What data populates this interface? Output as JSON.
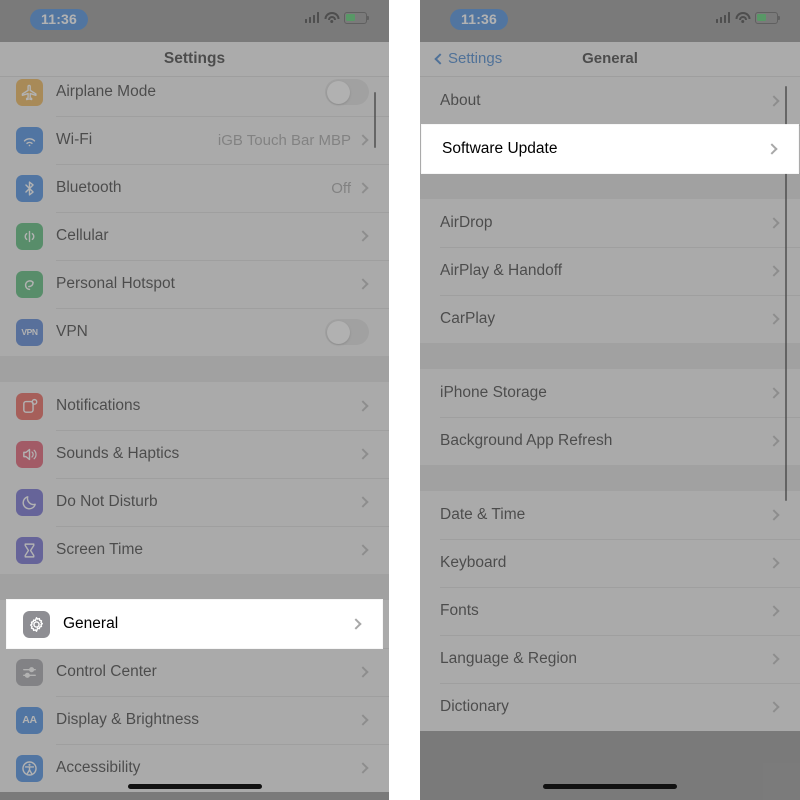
{
  "theme": {
    "accent": "#1a6fd4",
    "list_bg": "#ededed",
    "group_gap_bg": "#d7d7d7",
    "dim_overlay": "#7b7b7b",
    "highlight_bg": "#ffffff",
    "chevron": "#a8a8a8"
  },
  "left_phone": {
    "status_bar": {
      "time": "11:36",
      "cellular_icon": "cellular-signal-icon",
      "wifi_icon": "wifi-icon",
      "battery_icon": "battery-icon",
      "battery_level_percent": 46
    },
    "nav": {
      "title": "Settings"
    },
    "groups": [
      {
        "rows": [
          {
            "label": "Airplane Mode",
            "icon": "airplane-icon",
            "icon_class": "ic-airplane",
            "accessory": "toggle",
            "toggle_on": false,
            "clipped": true
          },
          {
            "label": "Wi-Fi",
            "icon": "wifi-icon",
            "icon_class": "ic-wifi",
            "accessory": "chevron",
            "value": "iGB Touch Bar MBP"
          },
          {
            "label": "Bluetooth",
            "icon": "bluetooth-icon",
            "icon_class": "ic-bluetooth",
            "accessory": "chevron",
            "value": "Off"
          },
          {
            "label": "Cellular",
            "icon": "cellular-icon",
            "icon_class": "ic-cellular",
            "accessory": "chevron",
            "value": ""
          },
          {
            "label": "Personal Hotspot",
            "icon": "hotspot-icon",
            "icon_class": "ic-hotspot",
            "accessory": "chevron",
            "value": ""
          },
          {
            "label": "VPN",
            "icon": "vpn-icon",
            "icon_class": "ic-vpn",
            "accessory": "toggle",
            "toggle_on": false
          }
        ]
      },
      {
        "rows": [
          {
            "label": "Notifications",
            "icon": "notifications-icon",
            "icon_class": "ic-notif",
            "accessory": "chevron",
            "value": ""
          },
          {
            "label": "Sounds & Haptics",
            "icon": "sounds-icon",
            "icon_class": "ic-sounds",
            "accessory": "chevron",
            "value": ""
          },
          {
            "label": "Do Not Disturb",
            "icon": "moon-icon",
            "icon_class": "ic-dnd",
            "accessory": "chevron",
            "value": ""
          },
          {
            "label": "Screen Time",
            "icon": "hourglass-icon",
            "icon_class": "ic-screentime",
            "accessory": "chevron",
            "value": ""
          }
        ]
      },
      {
        "rows": [
          {
            "label": "General",
            "icon": "gear-icon",
            "icon_class": "ic-general",
            "accessory": "chevron",
            "value": "",
            "highlighted": true
          },
          {
            "label": "Control Center",
            "icon": "control-center-icon",
            "icon_class": "ic-control",
            "accessory": "chevron",
            "value": ""
          },
          {
            "label": "Display & Brightness",
            "icon": "display-brightness-icon",
            "icon_class": "ic-display",
            "accessory": "chevron",
            "value": ""
          },
          {
            "label": "Accessibility",
            "icon": "accessibility-icon",
            "icon_class": "ic-access",
            "accessory": "chevron",
            "value": ""
          }
        ]
      }
    ]
  },
  "right_phone": {
    "status_bar": {
      "time": "11:36",
      "cellular_icon": "cellular-signal-icon",
      "wifi_icon": "wifi-icon",
      "battery_icon": "battery-icon",
      "battery_level_percent": 46
    },
    "nav": {
      "back_label": "Settings",
      "title": "General",
      "back_icon": "chevron-left-icon"
    },
    "groups": [
      {
        "rows": [
          {
            "label": "About",
            "accessory": "chevron"
          },
          {
            "label": "Software Update",
            "accessory": "chevron",
            "highlighted": true
          }
        ]
      },
      {
        "rows": [
          {
            "label": "AirDrop",
            "accessory": "chevron"
          },
          {
            "label": "AirPlay & Handoff",
            "accessory": "chevron"
          },
          {
            "label": "CarPlay",
            "accessory": "chevron"
          }
        ]
      },
      {
        "rows": [
          {
            "label": "iPhone Storage",
            "accessory": "chevron"
          },
          {
            "label": "Background App Refresh",
            "accessory": "chevron"
          }
        ]
      },
      {
        "rows": [
          {
            "label": "Date & Time",
            "accessory": "chevron"
          },
          {
            "label": "Keyboard",
            "accessory": "chevron"
          },
          {
            "label": "Fonts",
            "accessory": "chevron"
          },
          {
            "label": "Language & Region",
            "accessory": "chevron"
          },
          {
            "label": "Dictionary",
            "accessory": "chevron"
          }
        ]
      }
    ]
  }
}
